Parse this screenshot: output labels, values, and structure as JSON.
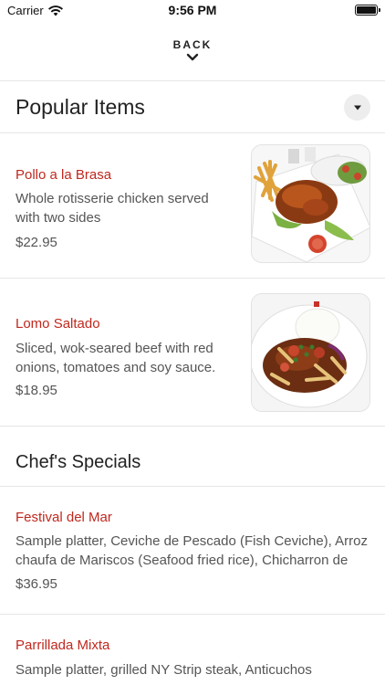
{
  "status_bar": {
    "carrier": "Carrier",
    "time": "9:56 PM",
    "battery_level": 1.0
  },
  "nav": {
    "back_label": "BACK"
  },
  "sections": [
    {
      "title": "Popular Items",
      "items": [
        {
          "name": "Pollo a la Brasa",
          "description": "Whole rotisserie chicken served with two sides",
          "price": "$22.95"
        },
        {
          "name": "Lomo Saltado",
          "description": "Sliced, wok-seared beef with red onions, tomatoes and soy sauce. S…",
          "price": "$18.95"
        }
      ]
    },
    {
      "title": "Chef's Specials",
      "items": [
        {
          "name": "Festival del Mar",
          "description": "Sample platter, Ceviche de Pescado (Fish Ceviche), Arroz chaufa de Mariscos (Seafood fried rice), Chicharron de C…",
          "price": "$36.95"
        },
        {
          "name": "Parrillada Mixta",
          "description": "Sample platter, grilled NY Strip steak, Anticuchos",
          "price": ""
        }
      ]
    }
  ],
  "colors": {
    "item_name": "#c0281e",
    "text": "#222222",
    "muted": "#555555",
    "divider": "#e6e6e6"
  }
}
